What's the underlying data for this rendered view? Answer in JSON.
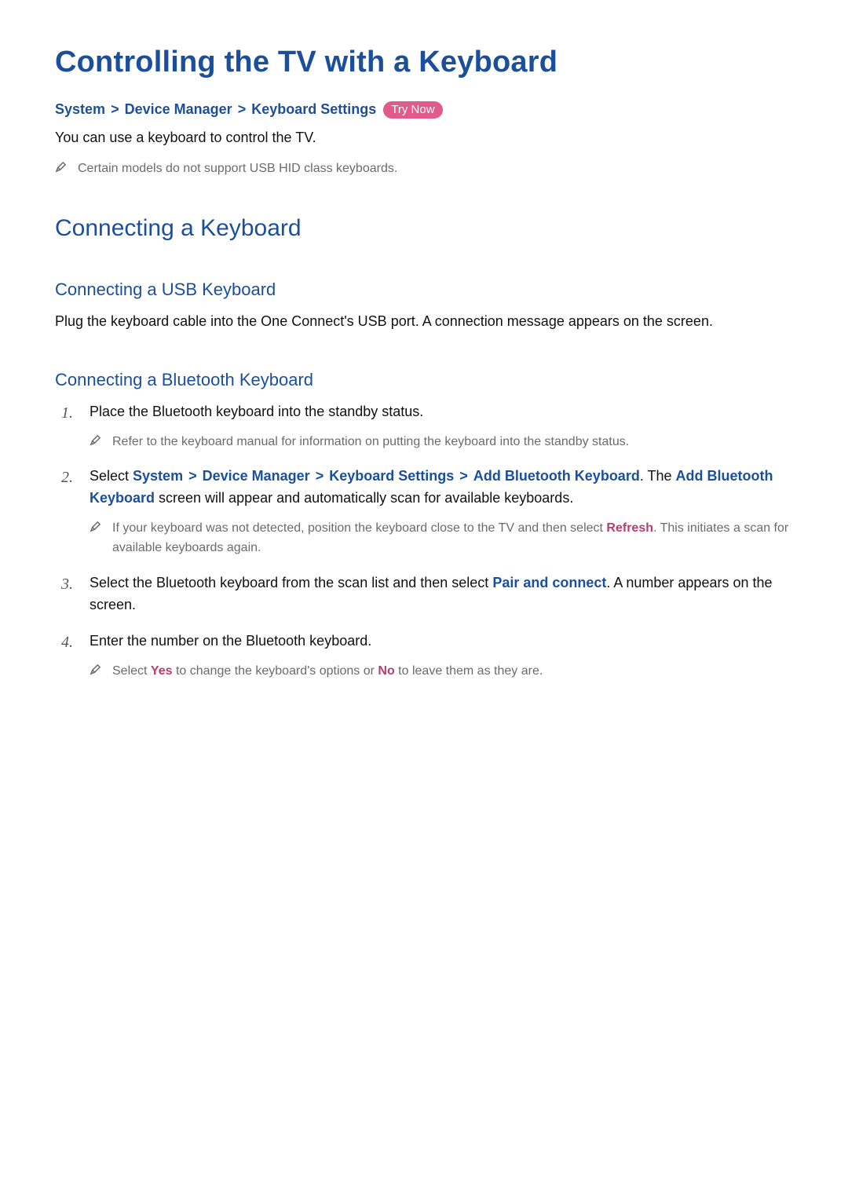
{
  "title": "Controlling the TV with a Keyboard",
  "breadcrumb": {
    "items": [
      "System",
      "Device Manager",
      "Keyboard Settings"
    ],
    "sep": ">",
    "try_now": "Try Now"
  },
  "intro": {
    "body": "You can use a keyboard to control the TV.",
    "note": "Certain models do not support USB HID class keyboards."
  },
  "section1": {
    "heading": "Connecting a Keyboard",
    "usb": {
      "heading": "Connecting a USB Keyboard",
      "body": "Plug the keyboard cable into the One Connect's USB port. A connection message appears on the screen."
    },
    "bt": {
      "heading": "Connecting a Bluetooth Keyboard",
      "steps": {
        "s1": {
          "text": "Place the Bluetooth keyboard into the standby status.",
          "note": "Refer to the keyboard manual for information on putting the keyboard into the standby status."
        },
        "s2": {
          "lead": "Select ",
          "path": [
            "System",
            "Device Manager",
            "Keyboard Settings",
            "Add Bluetooth Keyboard"
          ],
          "after_path": ". The ",
          "kw_add": "Add Bluetooth Keyboard",
          "tail": " screen will appear and automatically scan for available keyboards.",
          "note_a": "If your keyboard was not detected, position the keyboard close to the TV and then select ",
          "note_kw": "Refresh",
          "note_b": ". This initiates a scan for available keyboards again."
        },
        "s3": {
          "a": "Select the Bluetooth keyboard from the scan list and then select ",
          "kw": "Pair and connect",
          "b": ". A number appears on the screen."
        },
        "s4": {
          "text": "Enter the number on the Bluetooth keyboard.",
          "note_a": "Select ",
          "note_yes": "Yes",
          "note_mid": " to change the keyboard's options or ",
          "note_no": "No",
          "note_b": " to leave them as they are."
        }
      }
    }
  }
}
